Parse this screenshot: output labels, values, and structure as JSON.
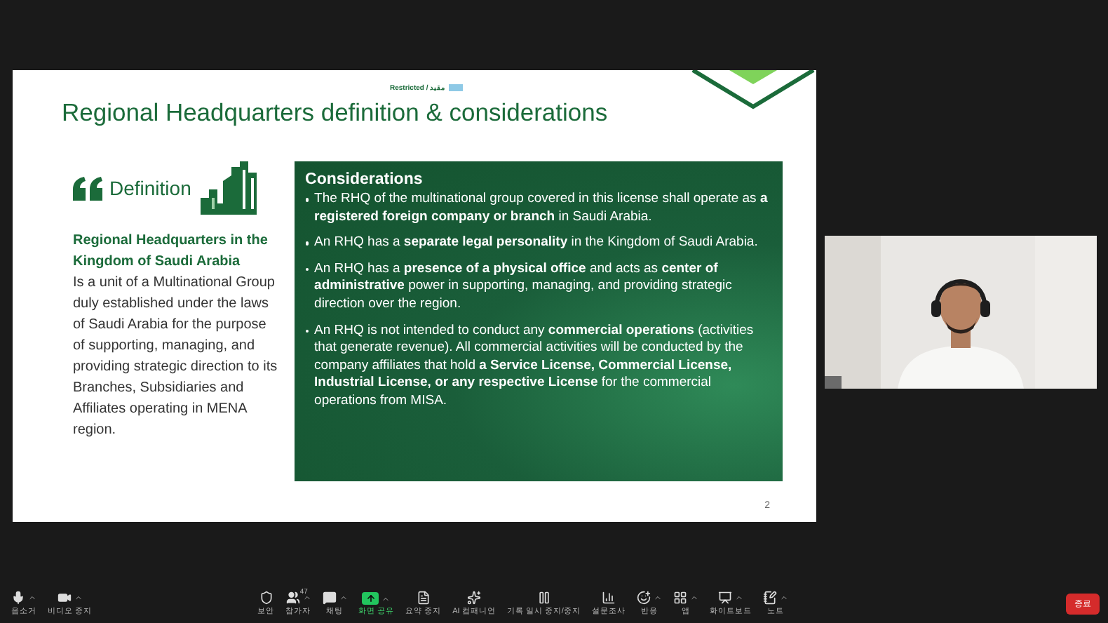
{
  "slide": {
    "classification": "Restricted / مقيد",
    "title": "Regional Headquarters definition & considerations",
    "definition": {
      "heading": "Definition",
      "subtitle": "Regional Headquarters in the Kingdom of Saudi Arabia",
      "body": "Is a unit of a Multinational Group duly established under the laws of Saudi Arabia for the purpose of supporting, managing, and providing strategic direction to its Branches, Subsidiaries and Affiliates operating in MENA region."
    },
    "considerations": {
      "heading": "Considerations",
      "bullets": [
        "The RHQ of the multinational group covered in this license shall operate as **a registered foreign company or branch** in Saudi Arabia.",
        "An RHQ has a **separate legal personality** in the Kingdom of Saudi Arabia.",
        "An RHQ has a **presence of a physical office** and acts as **center of administrative** power in supporting, managing, and providing strategic direction over the region.",
        "An RHQ is not intended to conduct any **commercial operations** (activities that generate revenue). All commercial activities will be conducted by the company affiliates that hold **a Service License, Commercial License, Industrial License, or any respective License** for the commercial operations from MISA."
      ]
    },
    "page_number": "2"
  },
  "toolbar": {
    "left": [
      {
        "kind": "mic",
        "label": "음소거",
        "menu": true,
        "selected": false
      },
      {
        "kind": "video",
        "label": "비디오 중지",
        "menu": true,
        "selected": false
      }
    ],
    "center": [
      {
        "kind": "shield",
        "label": "보안",
        "menu": false,
        "selected": false
      },
      {
        "kind": "users",
        "label": "참가자",
        "badge": "47",
        "menu": true,
        "selected": false
      },
      {
        "kind": "chat",
        "label": "채팅",
        "menu": true,
        "selected": false
      },
      {
        "kind": "share",
        "label": "화면 공유",
        "menu": true,
        "selected": true
      },
      {
        "kind": "doc",
        "label": "요약 중지",
        "menu": false,
        "selected": false
      },
      {
        "kind": "ai",
        "label": "AI 컴패니언",
        "menu": false,
        "selected": false
      },
      {
        "kind": "record",
        "label": "기록 일시 중지/중지",
        "menu": false,
        "selected": false
      },
      {
        "kind": "poll",
        "label": "설문조사",
        "menu": false,
        "selected": false
      },
      {
        "kind": "react",
        "label": "반응",
        "menu": true,
        "selected": false
      },
      {
        "kind": "apps",
        "label": "앱",
        "menu": true,
        "selected": false
      },
      {
        "kind": "board",
        "label": "화이트보드",
        "menu": true,
        "selected": false
      },
      {
        "kind": "notes",
        "label": "노트",
        "menu": true,
        "selected": false
      }
    ],
    "end_button": "종료"
  }
}
